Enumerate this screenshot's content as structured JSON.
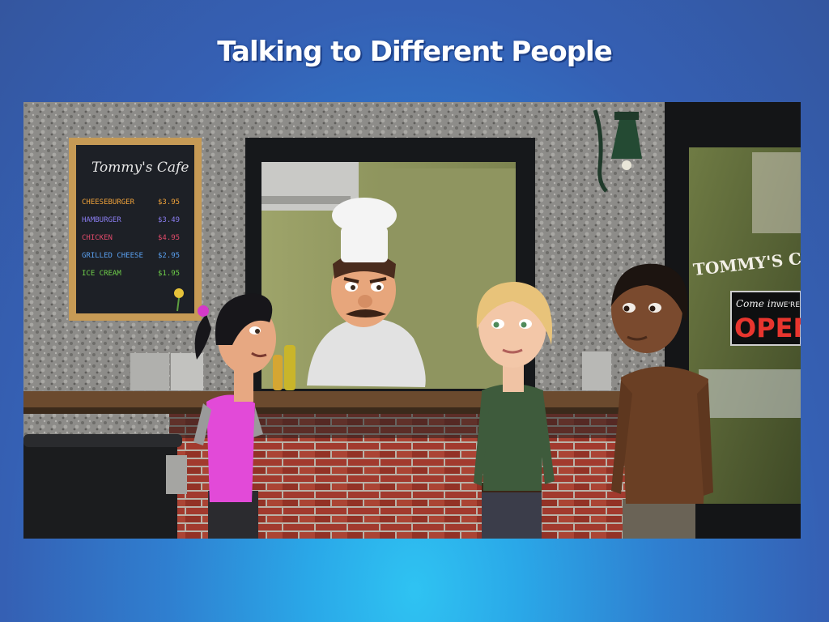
{
  "slide": {
    "title": "Talking to Different People"
  },
  "scene": {
    "menu_board": {
      "heading": "Tommy's Cafe",
      "items": [
        {
          "name": "CHEESEBURGER",
          "price": "$3.95",
          "color": "#f0a23a"
        },
        {
          "name": "HAMBURGER",
          "price": "$3.49",
          "color": "#8a7df0"
        },
        {
          "name": "CHICKEN",
          "price": "$4.95",
          "color": "#e04a6a"
        },
        {
          "name": "GRILLED CHEESE",
          "price": "$2.95",
          "color": "#5aa0f0"
        },
        {
          "name": "ICE CREAM",
          "price": "$1.95",
          "color": "#6fd04a"
        }
      ]
    },
    "window_sign": "TOMMY'S CA",
    "open_sign": {
      "line1": "Come in",
      "line2": "WE'RE",
      "line3": "OPEN"
    }
  },
  "colors": {
    "background_top": "#34569f",
    "background_glow": "#2fc3f2",
    "title_text": "#ffffff"
  }
}
